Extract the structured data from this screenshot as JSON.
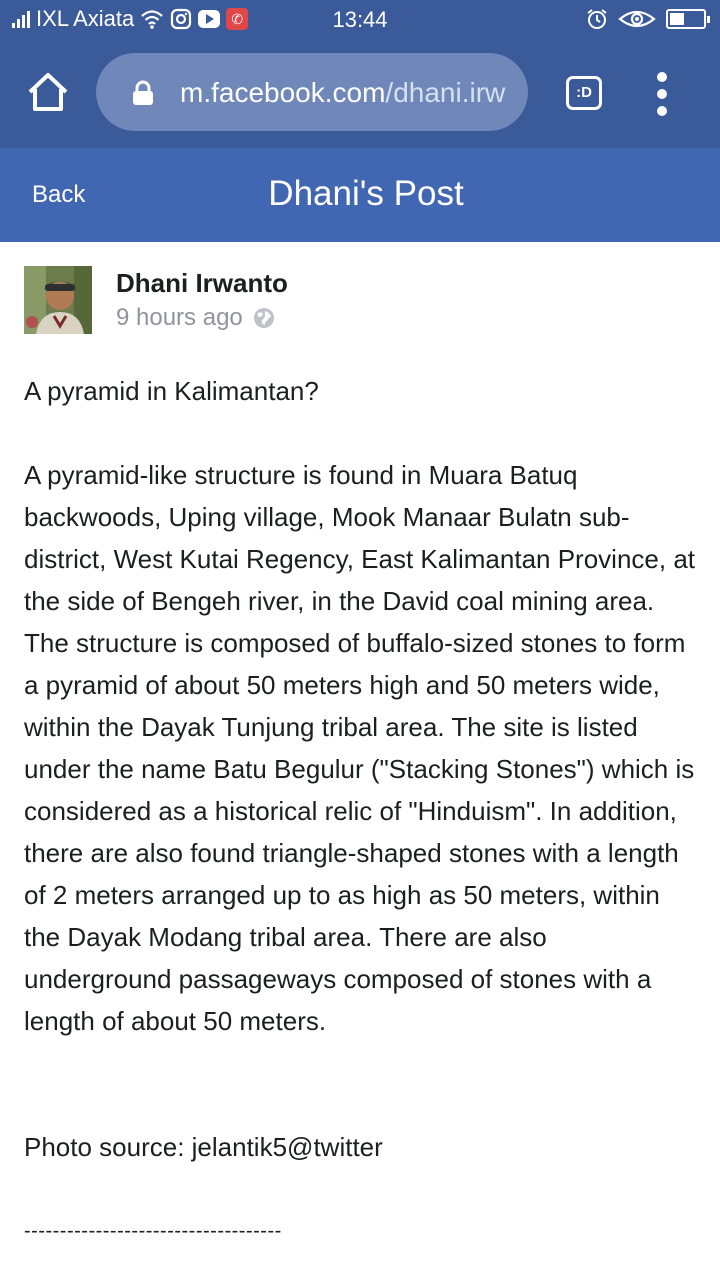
{
  "status_bar": {
    "carrier": "IXL Axiata",
    "time": "13:44",
    "icons": [
      "signal-icon",
      "wifi-icon",
      "instagram-icon",
      "youtube-icon",
      "call-icon",
      "alarm-icon",
      "eye-icon",
      "battery-icon"
    ]
  },
  "browser": {
    "url_domain": "m.facebook.com",
    "url_path": "/dhani.irw",
    "tab_label": ":D",
    "icons": [
      "home-icon",
      "lock-icon",
      "tab-switcher-icon",
      "more-vertical-icon"
    ]
  },
  "header": {
    "back_label": "Back",
    "title": "Dhani's Post",
    "color": "#4267b2"
  },
  "post": {
    "author": "Dhani Irwanto",
    "time": "9 hours ago",
    "title_line": "A pyramid in Kalimantan?",
    "text": "A pyramid-like structure is found in Muara Batuq backwoods, Uping village, Mook Manaar Bulatn sub-district, West Kutai Regency, East Kalimantan Province, at the side of Bengeh river, in the David coal mining area. The structure is composed of buffalo-sized stones to form a pyramid of about 50 meters high and 50 meters wide, within the Dayak Tunjung tribal area. The site is listed under the name Batu Begulur (\"Stacking Stones\") which is considered as a historical relic of \"Hinduism\". In addition, there are also found triangle-shaped stones with a length of 2 meters arranged up to as high as 50 meters, within the Dayak Modang tribal area. There are also underground passageways composed of stones with a length of about 50 meters.",
    "photo_source": "Photo source: jelantik5@twitter",
    "divider": "------------------------------------"
  },
  "colors": {
    "status_bar": "#3b5a9a",
    "url_pill": "#6f87b9",
    "text": "#1c1e21",
    "meta": "#90949c"
  }
}
